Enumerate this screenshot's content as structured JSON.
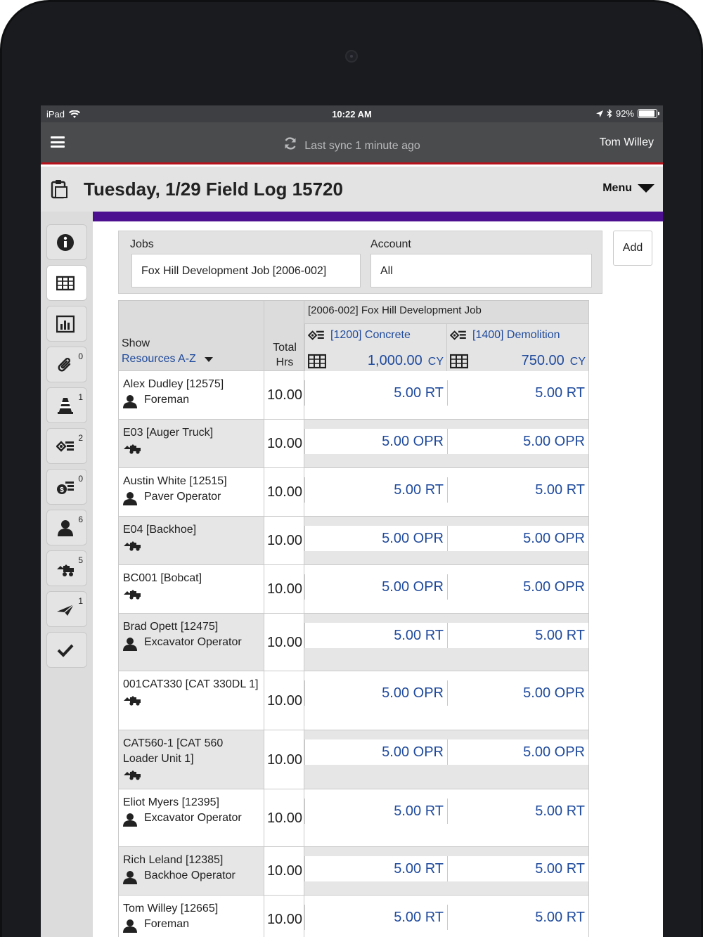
{
  "status_bar": {
    "device": "iPad",
    "time": "10:22 AM",
    "battery": "92%",
    "battery_level": 0.92
  },
  "header": {
    "sync_text": "Last sync 1 minute ago",
    "user": "Tom Willey"
  },
  "title": {
    "text": "Tuesday, 1/29 Field Log 15720",
    "menu_label": "Menu"
  },
  "sidebar": {
    "items": [
      {
        "icon": "info-icon",
        "badge": ""
      },
      {
        "icon": "grid-icon",
        "badge": "",
        "active": true
      },
      {
        "icon": "chart-icon",
        "badge": ""
      },
      {
        "icon": "paperclip-icon",
        "badge": "0"
      },
      {
        "icon": "cone-icon",
        "badge": "1"
      },
      {
        "icon": "cost-code-icon",
        "badge": "2"
      },
      {
        "icon": "money-icon",
        "badge": "0"
      },
      {
        "icon": "person-icon",
        "badge": "6"
      },
      {
        "icon": "equipment-icon",
        "badge": "5"
      },
      {
        "icon": "plane-icon",
        "badge": "1"
      },
      {
        "icon": "check-icon",
        "badge": ""
      }
    ]
  },
  "filters": {
    "jobs_label": "Jobs",
    "jobs_value": "Fox Hill Development Job [2006-002]",
    "account_label": "Account",
    "account_value": "All",
    "add_label": "Add"
  },
  "table": {
    "show_label": "Show",
    "sort_value": "Resources A-Z",
    "total_label_1": "Total",
    "total_label_2": "Hrs",
    "job_header": "[2006-002] Fox Hill Development Job",
    "cost_codes": [
      {
        "code": "[1200] Concrete",
        "qty": "1,000.00",
        "unit": "CY"
      },
      {
        "code": "[1400] Demolition",
        "qty": "750.00",
        "unit": "CY"
      }
    ],
    "rows": [
      {
        "name": "Alex Dudley [12575]",
        "role": "Foreman",
        "type": "person",
        "hours": "10.00",
        "c1": "5.00 RT",
        "c2": "5.00 RT"
      },
      {
        "name": "E03 [Auger Truck]",
        "role": "",
        "type": "equipment",
        "hours": "10.00",
        "c1": "5.00 OPR",
        "c2": "5.00 OPR"
      },
      {
        "name": "Austin White [12515]",
        "role": "Paver Operator",
        "type": "person",
        "hours": "10.00",
        "c1": "5.00 RT",
        "c2": "5.00 RT"
      },
      {
        "name": "E04 [Backhoe]",
        "role": "",
        "type": "equipment",
        "hours": "10.00",
        "c1": "5.00 OPR",
        "c2": "5.00 OPR"
      },
      {
        "name": "BC001 [Bobcat]",
        "role": "",
        "type": "equipment",
        "hours": "10.00",
        "c1": "5.00 OPR",
        "c2": "5.00 OPR"
      },
      {
        "name": "Brad Opett [12475]",
        "role": "Excavator Operator",
        "type": "person",
        "hours": "10.00",
        "c1": "5.00 RT",
        "c2": "5.00 RT"
      },
      {
        "name": "001CAT330 [CAT 330DL 1]",
        "role": "",
        "type": "equipment",
        "hours": "10.00",
        "c1": "5.00 OPR",
        "c2": "5.00 OPR"
      },
      {
        "name": "CAT560-1 [CAT 560 Loader Unit 1]",
        "role": "",
        "type": "equipment",
        "hours": "10.00",
        "c1": "5.00 OPR",
        "c2": "5.00 OPR"
      },
      {
        "name": "Eliot Myers [12395]",
        "role": "Excavator Operator",
        "type": "person",
        "hours": "10.00",
        "c1": "5.00 RT",
        "c2": "5.00 RT"
      },
      {
        "name": "Rich Leland [12385]",
        "role": "Backhoe Operator",
        "type": "person",
        "hours": "10.00",
        "c1": "5.00 RT",
        "c2": "5.00 RT"
      },
      {
        "name": "Tom Willey [12665]",
        "role": "Foreman",
        "type": "person",
        "hours": "10.00",
        "c1": "5.00 RT",
        "c2": "5.00 RT"
      }
    ]
  },
  "colors": {
    "accent_red": "#b5121b",
    "accent_purple": "#4b0f8f",
    "link_blue": "#1f4a9c"
  }
}
